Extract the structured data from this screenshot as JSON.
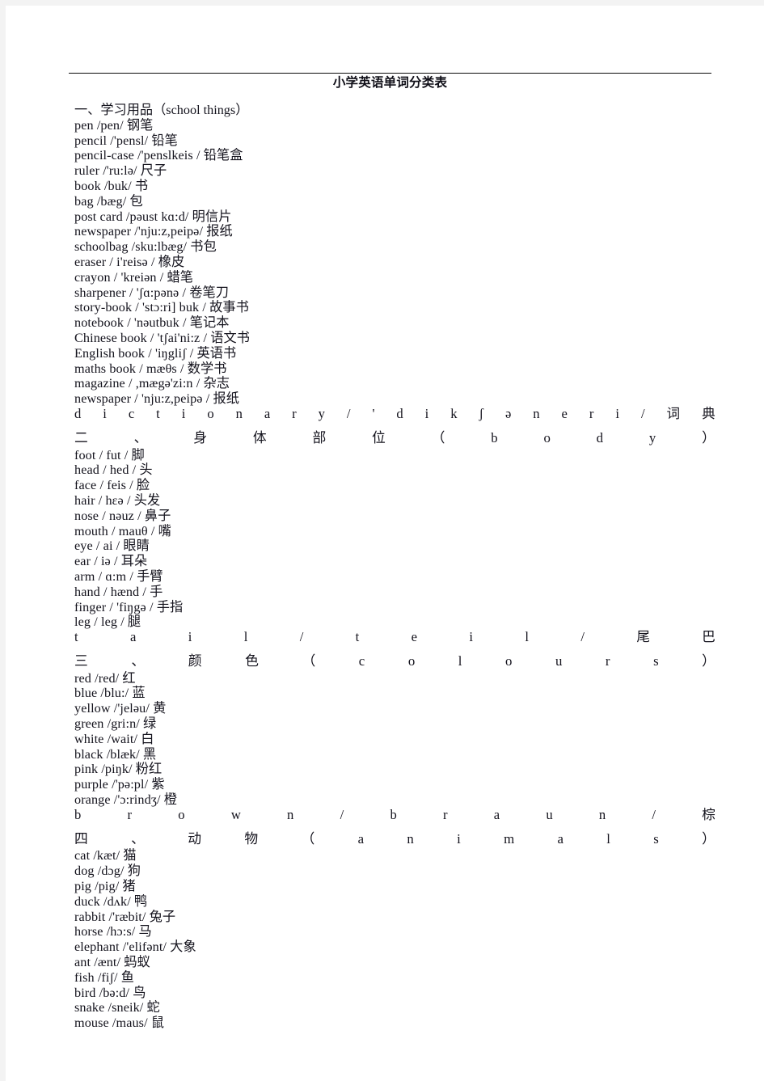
{
  "document": {
    "title": "小学英语单词分类表",
    "page_background": "#ffffff",
    "canvas_background": "#f3f3f3",
    "text_color": "#14131d"
  },
  "sections": [
    {
      "heading": "一、学习用品（school things）",
      "heading_justified": false,
      "entries": [
        "pen /pen/ 钢笔",
        "pencil /'pensl/ 铅笔",
        "pencil-case /'penslkeis / 铅笔盒",
        "ruler /'ru:lə/ 尺子",
        "book /buk/ 书",
        "bag /bæg/ 包",
        "post card /pəust kɑ:d/ 明信片",
        "newspaper /'nju:z,peipə/ 报纸",
        "schoolbag /sku:lbæg/ 书包",
        "eraser / i'reisə / 橡皮",
        "crayon / 'kreiən / 蜡笔",
        "sharpener / 'ʃɑ:pənə / 卷笔刀",
        "story-book / 'stɔ:ri] buk / 故事书",
        "notebook / 'nəutbuk / 笔记本",
        "Chinese book / 'tʃai'ni:z / 语文书",
        "English book / 'iŋgliʃ / 英语书",
        "maths book / mæθs / 数学书",
        "magazine / ,mægə'zi:n / 杂志",
        "newspaper / 'nju:z,peipə / 报纸"
      ],
      "justified_last": "dictionary / 'dikʃəneri / 词典"
    },
    {
      "heading": "二、身体部位（body）",
      "heading_justified": true,
      "entries": [
        "foot / fut / 脚",
        "head / hed / 头",
        "face / feis / 脸",
        "hair / hɛə / 头发",
        "nose / nəuz / 鼻子",
        "mouth / mauθ / 嘴",
        "eye / ai / 眼睛",
        "ear / iə / 耳朵",
        "arm / ɑ:m / 手臂",
        "hand / hænd / 手",
        "finger / 'fiŋgə / 手指",
        "leg / leg / 腿"
      ],
      "justified_last": "tail / teil / 尾巴"
    },
    {
      "heading": "三、颜色（colours）",
      "heading_justified": true,
      "entries": [
        "red /red/ 红",
        "blue /blu:/ 蓝",
        "yellow /'jeləu/ 黄",
        "green /gri:n/ 绿",
        "white /wait/ 白",
        "black /blæk/ 黑",
        "pink /piŋk/ 粉红",
        "purple /'pə:pl/ 紫",
        "orange /'ɔ:rindʒ/ 橙"
      ],
      "justified_last": "brown / braun / 棕"
    },
    {
      "heading": "四、动物（animals）",
      "heading_justified": true,
      "entries": [
        "cat /kæt/ 猫",
        "dog /dɔg/ 狗",
        "pig /pig/ 猪",
        "duck /dʌk/ 鸭",
        "rabbit /'ræbit/ 兔子",
        "horse /hɔ:s/ 马",
        "elephant /'elifənt/ 大象",
        "ant /ænt/ 蚂蚁",
        "fish /fiʃ/ 鱼",
        "bird /bə:d/ 鸟",
        "snake /sneik/ 蛇",
        "mouse /maus/ 鼠"
      ],
      "justified_last": null
    }
  ]
}
